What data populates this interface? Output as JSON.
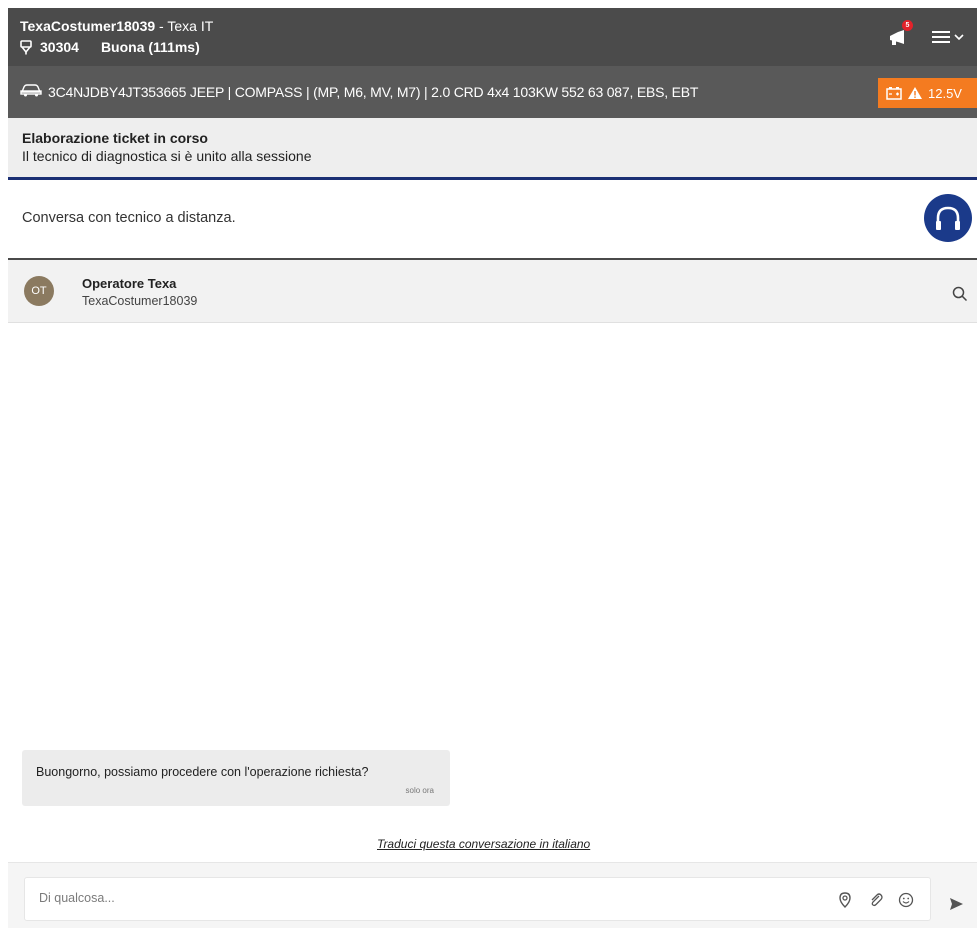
{
  "header": {
    "username": "TexaCostumer18039",
    "org_sep": " - ",
    "org": "Texa IT",
    "code": "30304",
    "connection": "Buona (111ms)",
    "notification_count": "5"
  },
  "vehicle": {
    "info": "3C4NJDBY4JT353665  JEEP | COMPASS | (MP, M6, MV, M7) | 2.0 CRD 4x4 103KW 552 63 087, EBS, EBT",
    "battery_voltage": "12.5V"
  },
  "status": {
    "title": "Elaborazione ticket in corso",
    "subtitle": "Il tecnico di diagnostica si è unito alla sessione"
  },
  "remote": {
    "text": "Conversa con tecnico a distanza."
  },
  "chat": {
    "avatar_initials": "OT",
    "operator_name": "Operatore Texa",
    "operator_user": "TexaCostumer18039",
    "messages": [
      {
        "text": "Buongorno, possiamo procedere con l'operazione richiesta?",
        "time": "solo ora"
      }
    ],
    "translate_link": "Traduci questa conversazione in italiano",
    "input_placeholder": "Di qualcosa..."
  },
  "colors": {
    "topbar": "#4b4b4b",
    "vehicle_bar": "#595959",
    "battery": "#f47b20",
    "accent": "#1b3a8a",
    "badge": "#e3222a"
  }
}
